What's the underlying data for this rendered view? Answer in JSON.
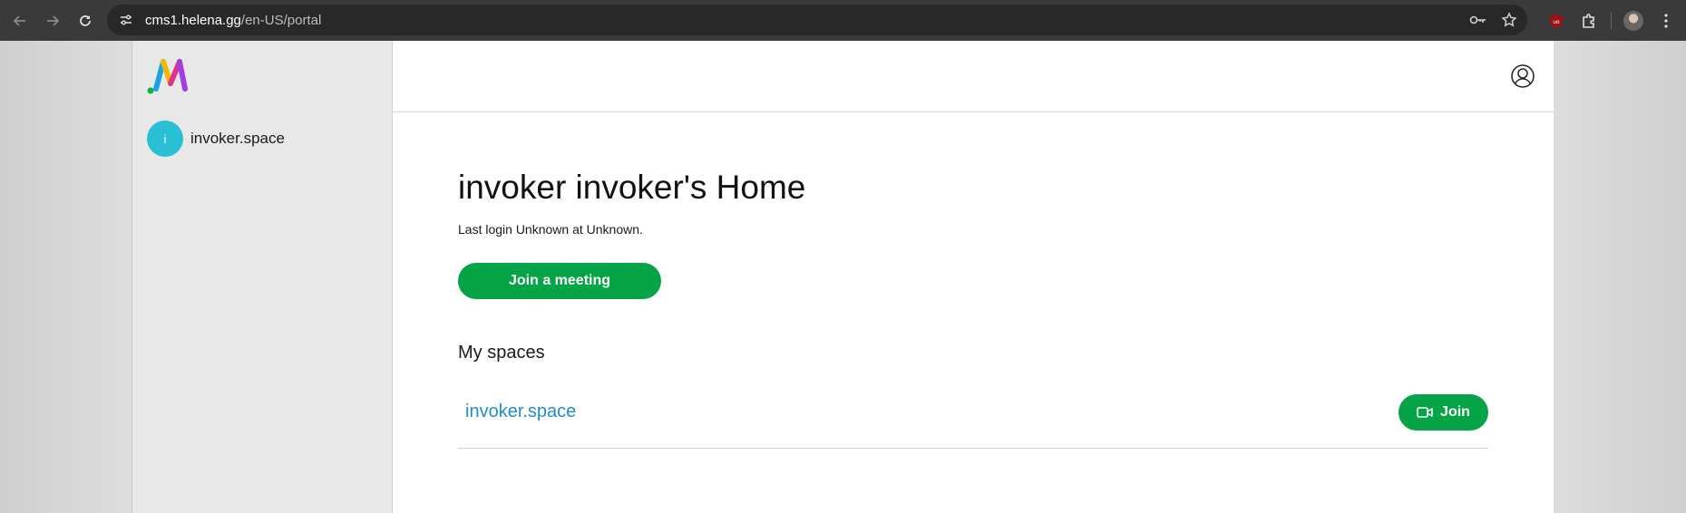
{
  "browser": {
    "url_host": "cms1.helena.gg",
    "url_path": "/en-US/portal",
    "icons": [
      "back-icon",
      "forward-icon",
      "reload-icon",
      "site-info-icon",
      "password-key-icon",
      "bookmark-star-icon",
      "ublock-icon",
      "extensions-icon",
      "profile-avatar",
      "menu-icon"
    ]
  },
  "sidebar": {
    "logo": "meeting-app-logo",
    "spaces": [
      {
        "initial": "i",
        "name": "invoker.space"
      }
    ]
  },
  "main": {
    "title": "invoker invoker's Home",
    "last_login": "Last login Unknown at Unknown.",
    "join_meeting_label": "Join a meeting",
    "my_spaces_heading": "My spaces",
    "space_rows": [
      {
        "name": "invoker.space",
        "join_label": "Join"
      }
    ]
  },
  "colors": {
    "accent_green": "#05a446",
    "link_blue": "#1e8fc6",
    "avatar_teal": "#29c0d6"
  }
}
